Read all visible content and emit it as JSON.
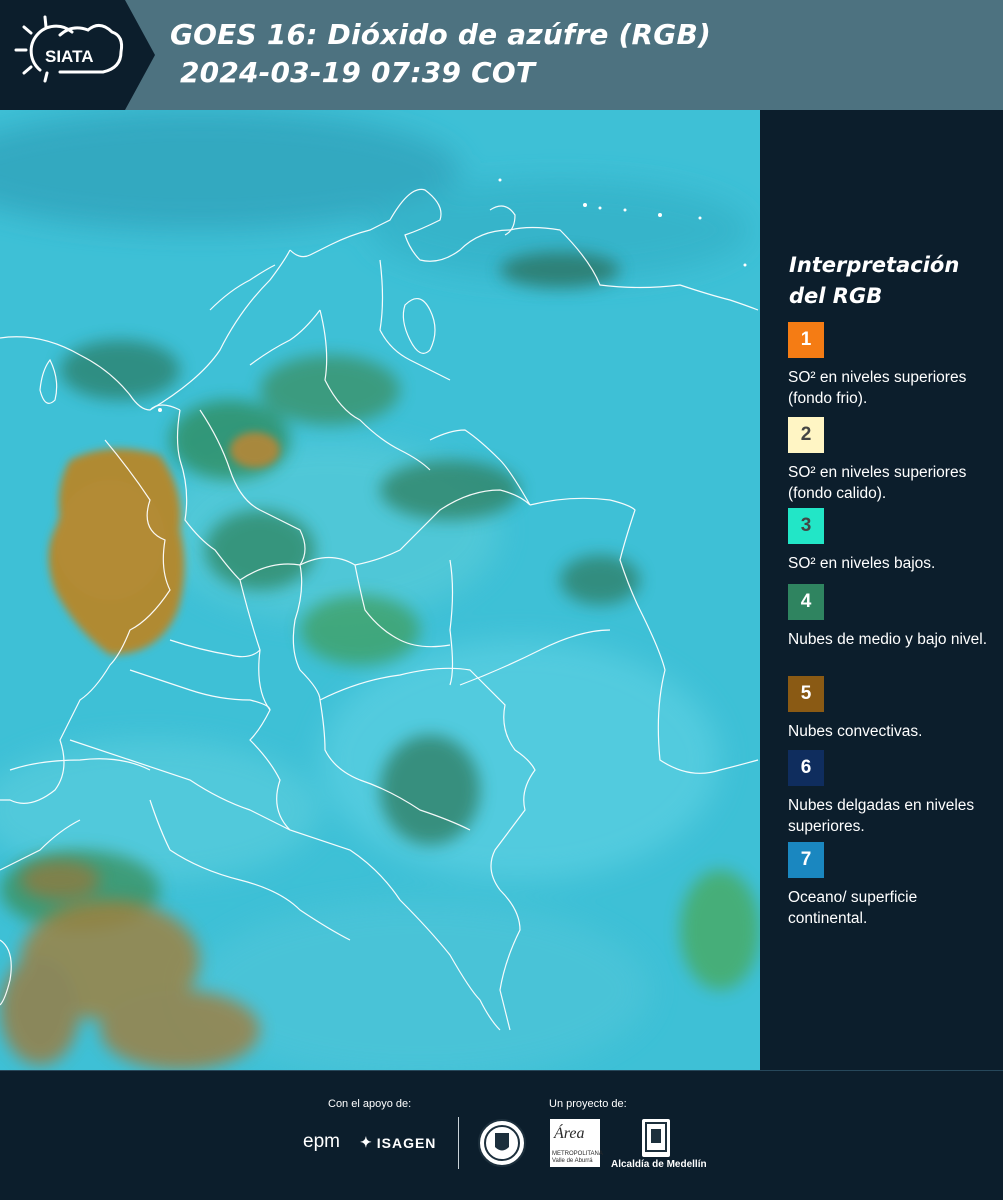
{
  "header": {
    "logo_text": "SIATA",
    "title_line1": "GOES 16: Dióxido de azúfre (RGB)",
    "title_line2": " 2024-03-19 07:39 COT"
  },
  "legend": {
    "title": "Interpretación del RGB",
    "items": [
      {
        "number": "1",
        "color": "#f57c14",
        "label": "SO² en niveles superiores (fondo frio)."
      },
      {
        "number": "2",
        "color": "#fff5c4",
        "label": "SO² en niveles superiores (fondo calido)."
      },
      {
        "number": "3",
        "color": "#22e6c7",
        "label": "SO² en niveles bajos."
      },
      {
        "number": "4",
        "color": "#2f8460",
        "label": "Nubes de medio y bajo nivel."
      },
      {
        "number": "5",
        "color": "#8a5a14",
        "label": "Nubes convectivas."
      },
      {
        "number": "6",
        "color": "#0f2d5e",
        "label": "Nubes delgadas en niveles superiores."
      },
      {
        "number": "7",
        "color": "#1a87c0",
        "label": "Oceano/ superficie continental."
      }
    ]
  },
  "footer": {
    "support_label": "Con el apoyo de:",
    "project_label": "Un proyecto de:",
    "sponsor_1": "epm",
    "sponsor_2": "ISAGEN",
    "partner_area": "Área",
    "partner_area_sub": "METROPOLITANA Valle de Aburrá",
    "partner_alcaldia": "Alcaldía de Medellín"
  }
}
